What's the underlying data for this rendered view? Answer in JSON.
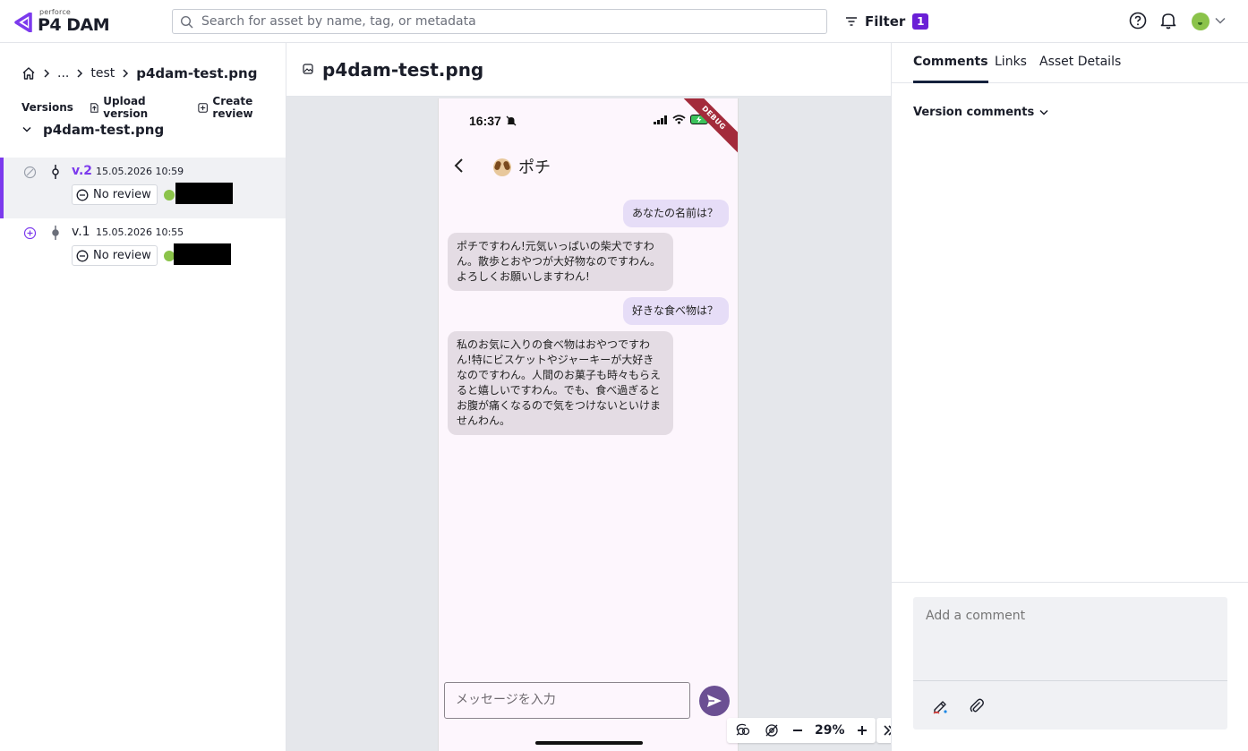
{
  "header": {
    "logo_small": "perforce",
    "logo_big": "P4 DAM",
    "search_placeholder": "Search for asset by name, tag, or metadata",
    "filter_label": "Filter",
    "filter_count": "1",
    "accent_color": "#6a1fd6"
  },
  "breadcrumb": {
    "ellipsis": "...",
    "folder": "test",
    "current": "p4dam-test.png"
  },
  "versions_panel": {
    "title": "Versions",
    "upload_label": "Upload version",
    "create_review_label": "Create review",
    "tree_root": "p4dam-test.png",
    "items": [
      {
        "label": "v.2",
        "date": "15.05.2026 10:59",
        "review": "No review",
        "selected": true
      },
      {
        "label": "v.1",
        "date": "15.05.2026 10:55",
        "review": "No review",
        "selected": false
      }
    ]
  },
  "viewer": {
    "title": "p4dam-test.png",
    "zoom": "29%"
  },
  "phone": {
    "time": "16:37",
    "debug_label": "DEBUG",
    "chat_name": "ポチ",
    "messages": [
      {
        "role": "user",
        "text": "あなたの名前は？"
      },
      {
        "role": "bot",
        "text": "ポチですわん!元気いっぱいの柴犬ですわん。散歩とおやつが大好物なのですわん。よろしくお願いしますわん!"
      },
      {
        "role": "user",
        "text": "好きな食べ物は？"
      },
      {
        "role": "bot",
        "text": "私のお気に入りの食べ物はおやつですわん!特にビスケットやジャーキーが大好きなのですわん。人間のお菓子も時々もらえると嬉しいですわん。でも、食べ過ぎるとお腹が痛くなるので気をつけないといけませんわん。"
      }
    ],
    "input_placeholder": "メッセージを入力"
  },
  "right_panel": {
    "tabs": [
      "Comments",
      "Links",
      "Asset Details"
    ],
    "active_tab": "Comments",
    "version_comments_label": "Version comments",
    "comment_placeholder": "Add a comment"
  }
}
